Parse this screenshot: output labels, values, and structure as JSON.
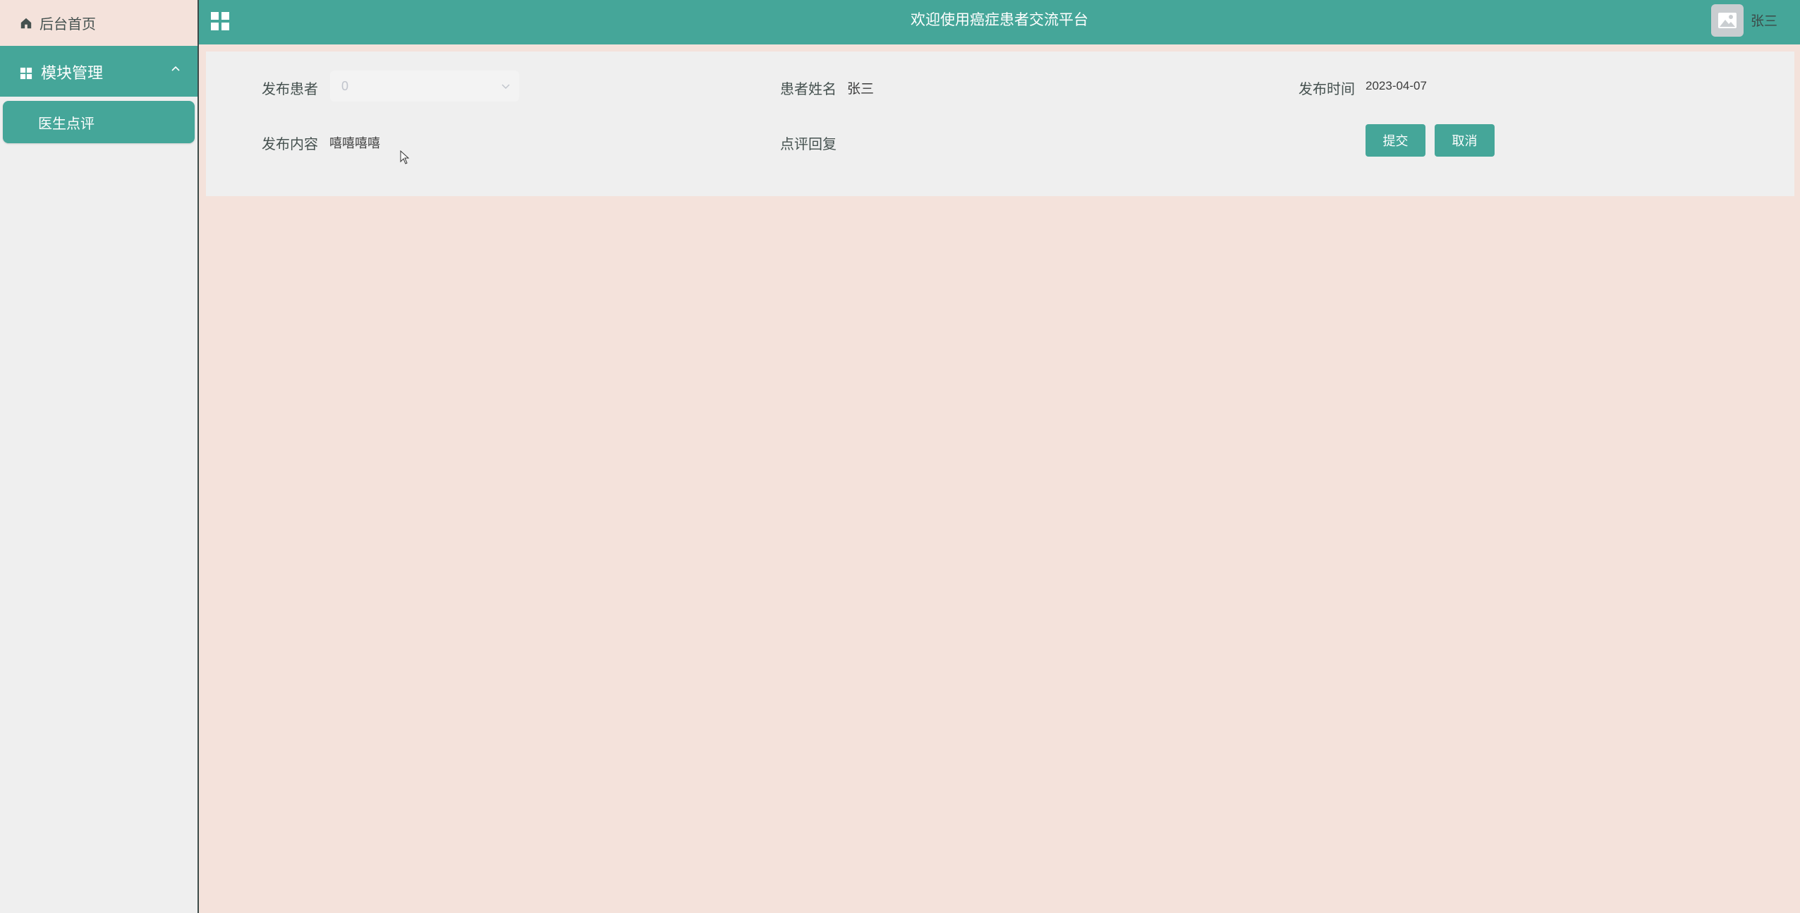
{
  "sidebar": {
    "home_label": "后台首页",
    "group_label": "模块管理",
    "sub_label": "医生点评"
  },
  "header": {
    "title": "欢迎使用癌症患者交流平台",
    "username": "张三"
  },
  "form": {
    "publisher_label": "发布患者",
    "publisher_value": "0",
    "patient_name_label": "患者姓名",
    "patient_name_value": "张三",
    "publish_time_label": "发布时间",
    "publish_time_value": "2023-04-07",
    "content_label": "发布内容",
    "content_value": "嘻嘻嘻嘻",
    "reply_label": "点评回复",
    "submit_label": "提交",
    "cancel_label": "取消"
  },
  "colors": {
    "accent": "#45a699",
    "background": "#f4e2db",
    "panel": "#efefef"
  }
}
